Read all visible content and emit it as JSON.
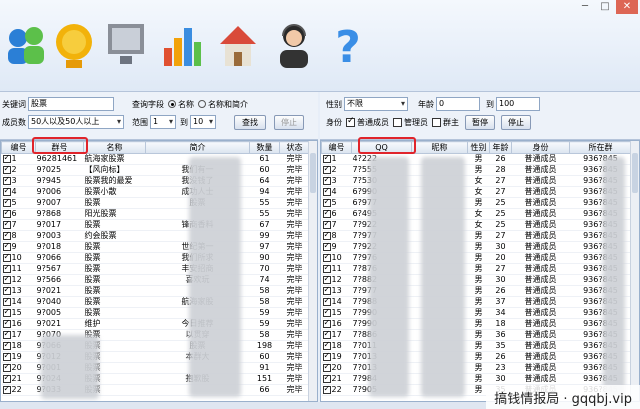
{
  "left_panel": {
    "keyword_label": "关键词",
    "keyword_value": "股票",
    "query_label": "查询字段",
    "radio_name": "名称",
    "radio_name_intro": "名称和简介",
    "members_label": "成员数",
    "members_value": "50人以及50人以上",
    "range_label": "范围",
    "range_from": "1",
    "range_to_label": "到",
    "range_to": "10",
    "search_button": "查找",
    "stop_button": "停止"
  },
  "left_table": {
    "columns": [
      "编号",
      "群号",
      "名称",
      "简介",
      "数量",
      "状态"
    ],
    "rows": [
      [
        "1",
        "96281461",
        "航海家股票",
        "",
        "61",
        "完毕"
      ],
      [
        "2",
        "9?025",
        "【风向标】",
        "我们有一",
        "60",
        "完毕"
      ],
      [
        "3",
        "9?945",
        "股票我的最爱",
        "我没钱了",
        "64",
        "完毕"
      ],
      [
        "4",
        "9?006",
        "股票小散",
        "成功人士",
        "94",
        "完毕"
      ],
      [
        "5",
        "9?007",
        "股票",
        "股票",
        "55",
        "完毕"
      ],
      [
        "6",
        "9?868",
        "阳光股票",
        "",
        "55",
        "完毕"
      ],
      [
        "7",
        "9?017",
        "股票",
        "锋商香料",
        "67",
        "完毕"
      ],
      [
        "8",
        "9?003",
        "约会股票",
        "",
        "99",
        "完毕"
      ],
      [
        "9",
        "9?018",
        "股票",
        "世纪第一",
        "97",
        "完毕"
      ],
      [
        "10",
        "9?066",
        "股票",
        "我们所求",
        "90",
        "完毕"
      ],
      [
        "11",
        "9?567",
        "股票",
        "丰安招商",
        "70",
        "完毕"
      ],
      [
        "12",
        "9?566",
        "股票",
        "喜欢玩",
        "74",
        "完毕"
      ],
      [
        "13",
        "9?021",
        "股票",
        "",
        "58",
        "完毕"
      ],
      [
        "14",
        "9?040",
        "股票",
        "航海家股",
        "58",
        "完毕"
      ],
      [
        "15",
        "9?005",
        "股票",
        "",
        "59",
        "完毕"
      ],
      [
        "16",
        "9?021",
        "维护",
        "今日推荐",
        "59",
        "完毕"
      ],
      [
        "17",
        "9?070",
        "股票",
        "以贯穿",
        "58",
        "完毕"
      ],
      [
        "18",
        "9?066",
        "股票",
        "股票",
        "198",
        "完毕"
      ],
      [
        "19",
        "9?012",
        "股票",
        "本群大",
        "60",
        "完毕"
      ],
      [
        "20",
        "9?001",
        "股票",
        "",
        "91",
        "完毕"
      ],
      [
        "21",
        "9?024",
        "股票",
        "抱歉股",
        "151",
        "完毕"
      ],
      [
        "22",
        "9?033",
        "股票",
        "",
        "66",
        "完毕"
      ]
    ]
  },
  "right_panel": {
    "gender_label": "性别",
    "gender_value": "不限",
    "age_label": "年龄",
    "age_from": "0",
    "age_to_label": "到",
    "age_to": "100",
    "identity_label": "身份",
    "opt_normal": "普通成员",
    "opt_admin": "管理员",
    "opt_owner": "群主",
    "pause_button": "暂停",
    "stop_button": "停止"
  },
  "right_table": {
    "columns": [
      "编号",
      "QQ",
      "昵称",
      "性别",
      "年龄",
      "身份",
      "所在群"
    ],
    "rows": [
      [
        "1",
        "4?222",
        "",
        "男",
        "26",
        "普通成员",
        "936?845"
      ],
      [
        "2",
        "7?555",
        "",
        "男",
        "28",
        "普通成员",
        "936?845"
      ],
      [
        "3",
        "7?530",
        "",
        "女",
        "27",
        "普通成员",
        "936?845"
      ],
      [
        "4",
        "6?990",
        "",
        "女",
        "27",
        "普通成员",
        "936?845"
      ],
      [
        "5",
        "6?977",
        "",
        "男",
        "25",
        "普通成员",
        "936?845"
      ],
      [
        "6",
        "6?495",
        "",
        "女",
        "25",
        "普通成员",
        "936?845"
      ],
      [
        "7",
        "7?922",
        "",
        "女",
        "25",
        "普通成员",
        "936?845"
      ],
      [
        "8",
        "7?977",
        "",
        "男",
        "27",
        "普通成员",
        "936?845"
      ],
      [
        "9",
        "7?922",
        "",
        "男",
        "30",
        "普通成员",
        "936?845"
      ],
      [
        "10",
        "7?976",
        "",
        "男",
        "20",
        "普通成员",
        "936?845"
      ],
      [
        "11",
        "7?876",
        "",
        "男",
        "27",
        "普通成员",
        "936?845"
      ],
      [
        "12",
        "7?882",
        "",
        "男",
        "30",
        "普通成员",
        "936?845"
      ],
      [
        "13",
        "7?977",
        "",
        "男",
        "26",
        "普通成员",
        "936?845"
      ],
      [
        "14",
        "7?988",
        "",
        "男",
        "37",
        "普通成员",
        "936?845"
      ],
      [
        "15",
        "7?990",
        "",
        "男",
        "34",
        "普通成员",
        "936?845"
      ],
      [
        "16",
        "7?990",
        "",
        "男",
        "18",
        "普通成员",
        "936?845"
      ],
      [
        "17",
        "7?886",
        "",
        "男",
        "36",
        "普通成员",
        "936?845"
      ],
      [
        "18",
        "7?011",
        "",
        "男",
        "35",
        "普通成员",
        "936?845"
      ],
      [
        "19",
        "7?013",
        "",
        "男",
        "26",
        "普通成员",
        "936?845"
      ],
      [
        "20",
        "7?013",
        "",
        "男",
        "23",
        "普通成员",
        "936?845"
      ],
      [
        "21",
        "7?984",
        "",
        "男",
        "30",
        "普通成员",
        "936?845"
      ],
      [
        "22",
        "7?905",
        "",
        "男",
        "35",
        "普通成员",
        "936?845"
      ]
    ]
  },
  "watermark": "搞钱情报局 · gqqbj.vip",
  "colors": {
    "highlight": "#e0242b",
    "header_bg": "#dbe4f0"
  }
}
